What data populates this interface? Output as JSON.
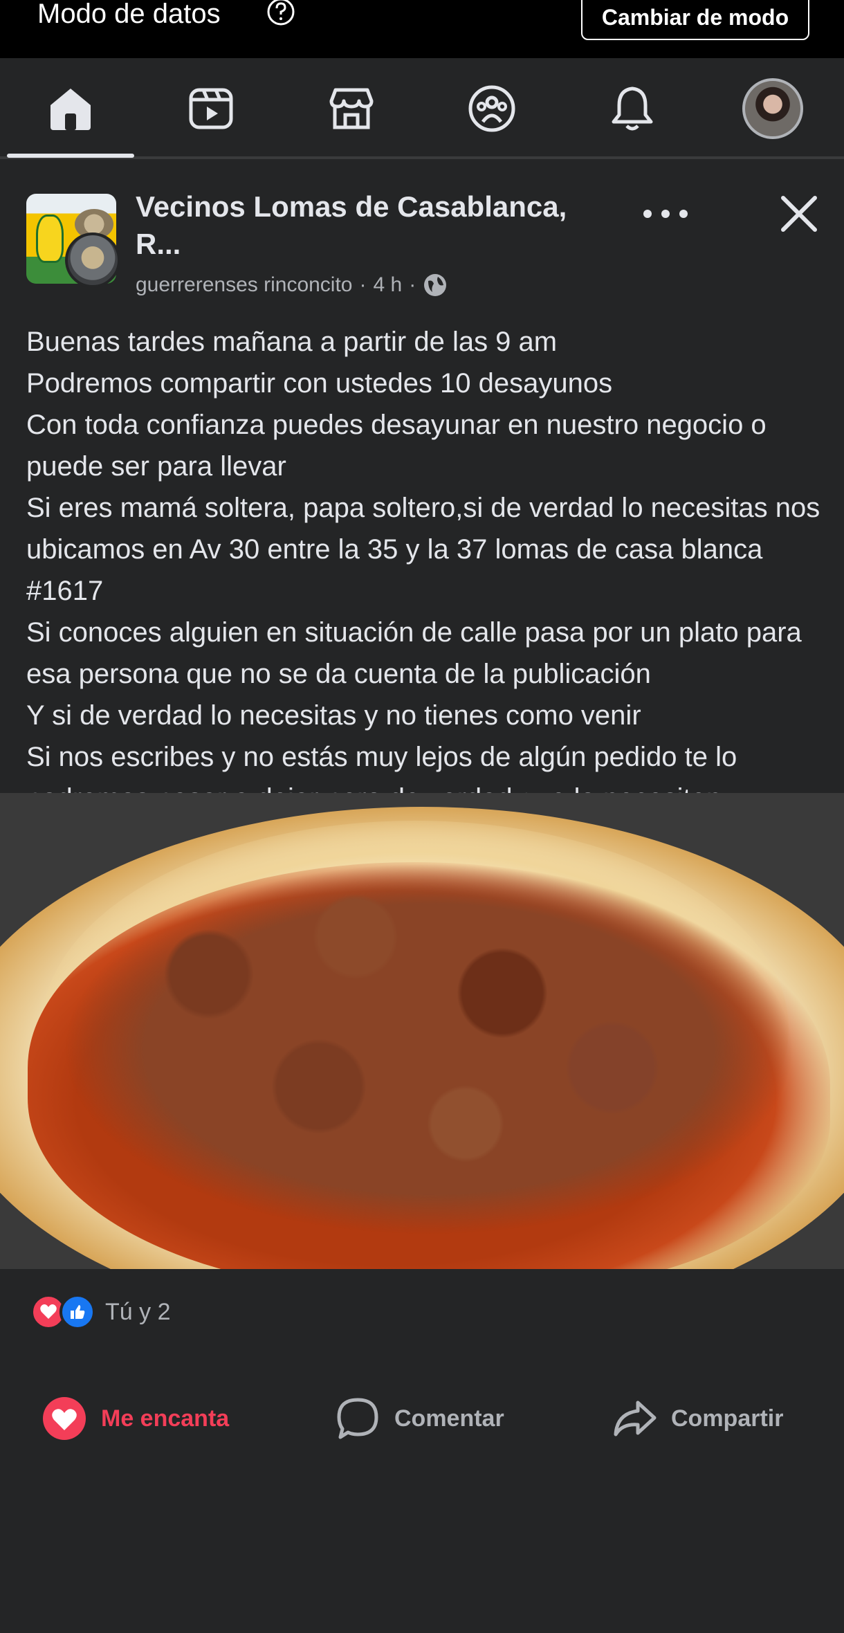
{
  "status_bar": {
    "label": "Modo de datos",
    "help_icon": "question-circle-icon",
    "button_label": "Cambiar de modo"
  },
  "nav": {
    "tabs": [
      {
        "name": "home",
        "icon": "home-icon",
        "active": true
      },
      {
        "name": "video",
        "icon": "video-icon",
        "active": false
      },
      {
        "name": "marketplace",
        "icon": "store-icon",
        "active": false
      },
      {
        "name": "groups",
        "icon": "groups-icon",
        "active": false
      },
      {
        "name": "notifications",
        "icon": "bell-icon",
        "active": false
      },
      {
        "name": "profile",
        "icon": "avatar",
        "active": false
      }
    ]
  },
  "post": {
    "group_name": "Vecinos Lomas de Casablanca, R...",
    "author": "guerrerenses rinconcito",
    "time": "4 h",
    "privacy_icon": "globe-icon",
    "text": "Buenas tardes mañana a partir de las 9 am\nPodremos compartir con ustedes 10 desayunos\nCon toda confianza puedes desayunar en nuestro negocio o puede ser para llevar\nSi eres mamá soltera, papa soltero,si de verdad lo necesitas nos ubicamos en Av 30 entre la 35 y la 37 lomas de casa blanca #1617\nSi conoces alguien en situación de calle pasa por un plato para esa persona que no se da cuenta de la publicación\nY si de verdad lo necesitas y no tienes como venir\nSi nos escribes y no estás muy lejos de algún pedido te lo podremos pasar a dejar pero de verdad que lo necesiten\nSi no,déjenlo para alguien más !!",
    "reactions_text": "Tú y 2",
    "actions": {
      "love_label": "Me encanta",
      "comment_label": "Comentar",
      "share_label": "Compartir"
    }
  },
  "colors": {
    "background": "#242526",
    "text": "#e4e6eb",
    "secondary_text": "#b0b3b8",
    "love": "#f33e58",
    "like": "#1877f2"
  }
}
